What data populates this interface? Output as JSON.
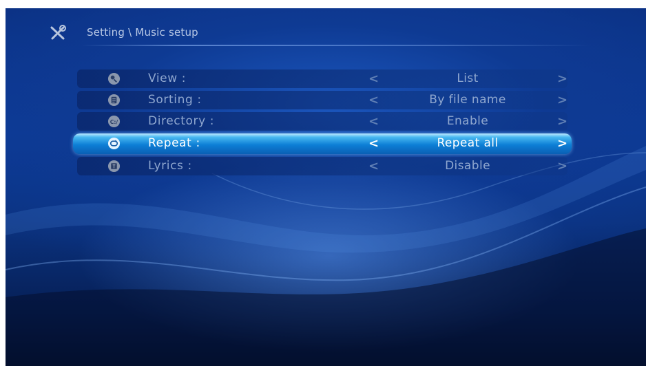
{
  "header": {
    "breadcrumb": "Setting \\ Music setup",
    "icon": "tools-icon"
  },
  "settings": [
    {
      "name": "view",
      "icon": "view-icon",
      "label": "View :",
      "value": "List",
      "selected": false
    },
    {
      "name": "sorting",
      "icon": "document-icon",
      "label": "Sorting :",
      "value": "By file name",
      "selected": false
    },
    {
      "name": "directory",
      "icon": "directory-icon",
      "icon_text": "C:/",
      "label": "Directory :",
      "value": "Enable",
      "selected": false
    },
    {
      "name": "repeat",
      "icon": "repeat-icon",
      "label": "Repeat :",
      "value": "Repeat all",
      "selected": true
    },
    {
      "name": "lyrics",
      "icon": "lyrics-icon",
      "label": "Lyrics :",
      "value": "Disable",
      "selected": false
    }
  ],
  "arrows": {
    "left": "<",
    "right": ">"
  },
  "colors": {
    "background": "#0c3a98",
    "selected_row": "#0d7fd6",
    "text_dim": "#8fa7cf",
    "text_selected": "#ffffff"
  }
}
